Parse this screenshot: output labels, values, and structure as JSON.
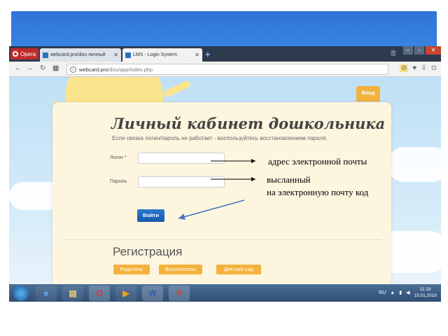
{
  "browser": {
    "menu_button": "Opera",
    "tabs": [
      {
        "label": "webcard.pro/dou личный"
      },
      {
        "label": "LMS - Login System"
      }
    ],
    "url_host": "webcard.pro",
    "url_path": "/dou/app/index.php"
  },
  "page": {
    "login_tab": "Вход",
    "title": "Личный кабинет дошкольника",
    "subtitle": "Если связка логин/пароль не работает - воспользуйтесь восстановлением пароля.",
    "login_label": "Логин *",
    "password_label": "Пароль",
    "submit_label": "Войти",
    "registration_title": "Регистрация",
    "roles": [
      "Родитель",
      "Воспитатель",
      "Детский сад"
    ]
  },
  "annotations": {
    "email_note": "адрес электронной почты",
    "code_note_line1": "высланный",
    "code_note_line2": "на электронную почту код"
  },
  "taskbar": {
    "language": "RU",
    "time": "11:18",
    "date": "15.01.2016"
  }
}
